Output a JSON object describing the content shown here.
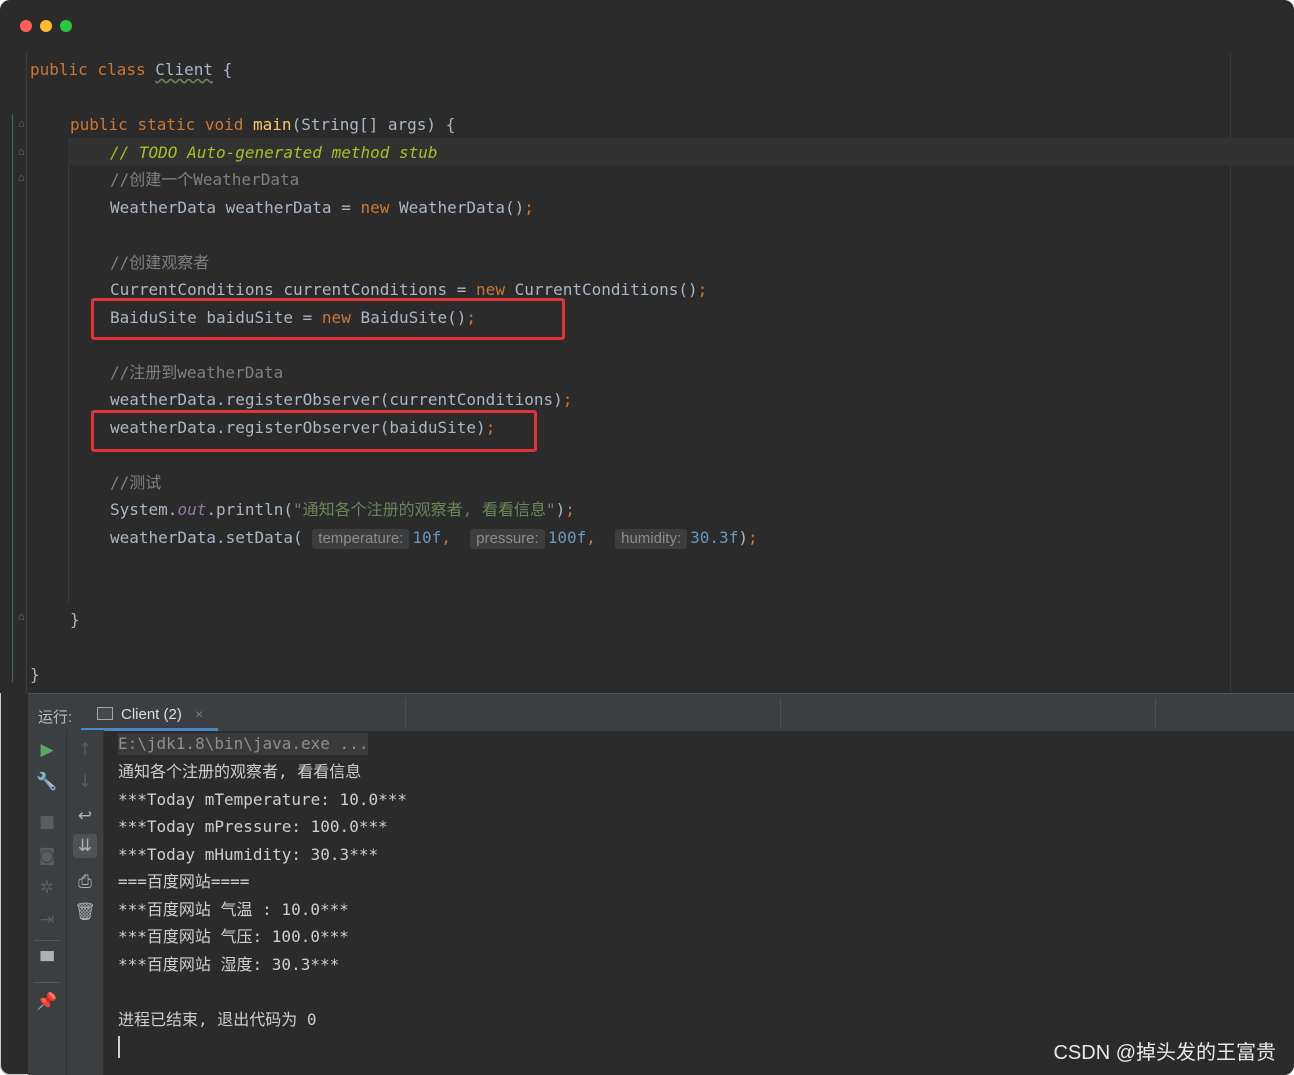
{
  "window": {
    "traffic_lights": {
      "close": "#ff5f57",
      "minimize": "#febc2e",
      "zoom": "#28c840"
    }
  },
  "code": {
    "line1": {
      "kw": "public class ",
      "name": "Client",
      "rest": " {"
    },
    "line2": {
      "kw": "public static void ",
      "fn": "main",
      "rest": "(String[] args) {"
    },
    "line3": {
      "prefix": "// ",
      "todo": "TODO Auto-generated method stub"
    },
    "line4": "//创建一个WeatherData",
    "line5": {
      "a": "WeatherData weatherData = ",
      "kw": "new",
      "b": " WeatherData()",
      "semi": ";"
    },
    "line6": "//创建观察者",
    "line7": {
      "a": "CurrentConditions currentConditions = ",
      "kw": "new",
      "b": " CurrentConditions()",
      "semi": ";"
    },
    "line8": {
      "a": "BaiduSite baiduSite = ",
      "kw": "new",
      "b": " BaiduSite()",
      "semi": ";"
    },
    "line9": "//注册到weatherData",
    "line10": {
      "a": "weatherData.registerObserver(currentConditions)",
      "semi": ";"
    },
    "line11": {
      "a": "weatherData.registerObserver(baiduSite)",
      "semi": ";"
    },
    "line12": "//测试",
    "line13": {
      "a": "System.",
      "field": "out",
      "b": ".println(",
      "str": "\"通知各个注册的观察者, 看看信息\"",
      "c": ")",
      "semi": ";"
    },
    "line14": {
      "a": "weatherData.setData(",
      "hint1": "temperature:",
      "v1": "10f",
      "comma1": ",",
      "hint2": "pressure:",
      "v2": "100f",
      "comma2": ",",
      "hint3": "humidity:",
      "v3": "30.3f",
      "c": ")",
      "semi": ";"
    },
    "close_method": "}",
    "close_class": "}"
  },
  "run_panel": {
    "label": "运行:",
    "tab_label": "Client (2)",
    "tab_close": "×",
    "console": [
      "E:\\jdk1.8\\bin\\java.exe ...",
      "通知各个注册的观察者, 看看信息",
      "***Today mTemperature: 10.0***",
      "***Today mPressure: 100.0***",
      "***Today mHumidity: 30.3***",
      "===百度网站====",
      "***百度网站 气温 : 10.0***",
      "***百度网站 气压: 100.0***",
      "***百度网站 湿度: 30.3***",
      "",
      "进程已结束, 退出代码为 0"
    ],
    "toolbar_left": [
      "run-icon",
      "wrench-icon",
      "stop-icon",
      "camera-icon",
      "debug-icon",
      "exit-icon",
      "layout-icon",
      "pin-icon"
    ],
    "toolbar_right": [
      "up-arrow-icon",
      "down-arrow-icon",
      "soft-wrap-icon",
      "scroll-to-end-icon",
      "print-icon",
      "trash-icon"
    ]
  },
  "watermark": "CSDN @掉头发的王富贵"
}
